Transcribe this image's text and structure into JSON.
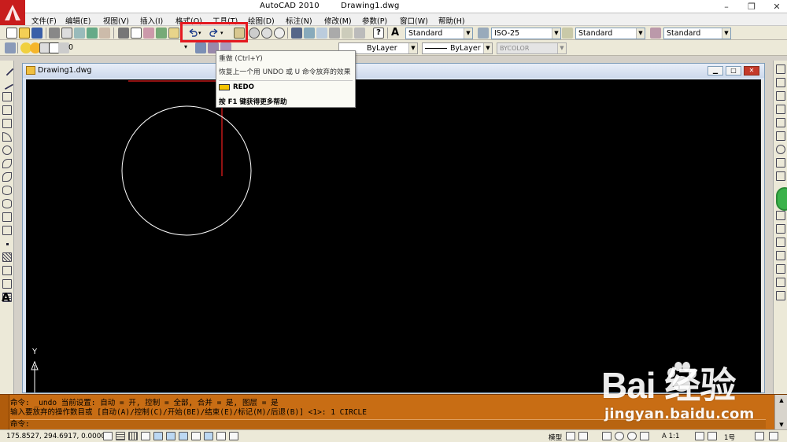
{
  "window": {
    "title_app": "AutoCAD 2010",
    "title_file": "Drawing1.dwg"
  },
  "menubar": {
    "items": [
      "文件(F)",
      "编辑(E)",
      "视图(V)",
      "插入(I)",
      "格式(O)",
      "工具(T)",
      "绘图(D)",
      "标注(N)",
      "修改(M)",
      "参数(P)",
      "窗口(W)",
      "帮助(H)"
    ]
  },
  "toolbar1": {
    "text_style": "Standard",
    "dim_style": "ISO-25",
    "table_style": "Standard",
    "multileader_style": "Standard"
  },
  "toolbar2": {
    "layer_name": "0",
    "color": "ByLayer",
    "linetype": "ByLayer",
    "plotstyle": "BYCOLOR"
  },
  "tooltip": {
    "title": "重做 (Ctrl+Y)",
    "description": "恢复上一个用 UNDO 或 U 命令放弃的效果",
    "command": "REDO",
    "help": "按 F1 键获得更多帮助"
  },
  "drawing": {
    "tab_title": "Drawing1.dwg",
    "ucs_y_label": "Y"
  },
  "command": {
    "line1": "命令:  _undo 当前设置: 自动 = 开, 控制 = 全部, 合并 = 是, 图层 = 是",
    "line2": "输入要放弃的操作数目或 [自动(A)/控制(C)/开始(BE)/结束(E)/标记(M)/后退(B)] <1>: 1 CIRCLE",
    "prompt": "命令:"
  },
  "status": {
    "coordinates": "175.8527, 294.6917, 0.0000",
    "model_label": "模型",
    "scale": "A 1:1",
    "workspace": "1号"
  },
  "watermark": {
    "brand": "Bai  经验",
    "url": "jingyan.baidu.com"
  },
  "colors": {
    "canvas": "#000000",
    "command_bg": "#c86d14",
    "highlight_box": "#e4191f",
    "circle": "#ffffff",
    "crosshair": "#c01818"
  }
}
